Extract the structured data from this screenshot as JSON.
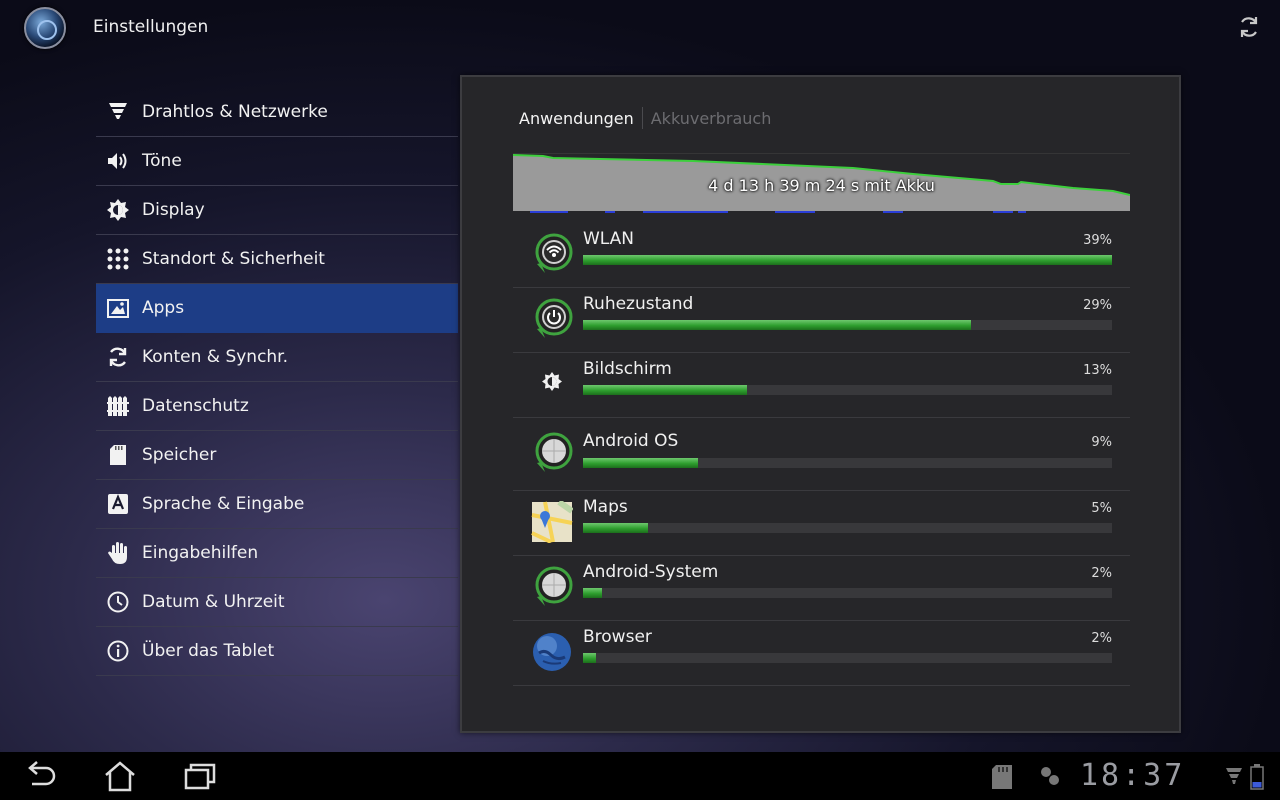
{
  "header": {
    "title": "Einstellungen"
  },
  "menu": [
    {
      "label": "Drahtlos & Netzwerke",
      "icon": "wifi-icon"
    },
    {
      "label": "Töne",
      "icon": "speaker-icon"
    },
    {
      "label": "Display",
      "icon": "brightness-icon"
    },
    {
      "label": "Standort & Sicherheit",
      "icon": "grid-icon"
    },
    {
      "label": "Apps",
      "icon": "apps-icon",
      "selected": true
    },
    {
      "label": "Konten & Synchr.",
      "icon": "sync-icon"
    },
    {
      "label": "Datenschutz",
      "icon": "fence-icon"
    },
    {
      "label": "Speicher",
      "icon": "sdcard-icon"
    },
    {
      "label": "Sprache & Eingabe",
      "icon": "keyboard-a-icon"
    },
    {
      "label": "Eingabehilfen",
      "icon": "hand-icon"
    },
    {
      "label": "Datum & Uhrzeit",
      "icon": "clock-icon"
    },
    {
      "label": "Über das Tablet",
      "icon": "info-icon"
    }
  ],
  "panel": {
    "tabs": {
      "active": "Anwendungen",
      "inactive": "Akkuverbrauch"
    },
    "battery_graph": {
      "label": "4 d 13 h 39 m 24 s mit Akku"
    },
    "usage": [
      {
        "name": "WLAN",
        "percent_label": "39%",
        "fraction": 1.0,
        "icon": "android-wifi-icon"
      },
      {
        "name": "Ruhezustand",
        "percent_label": "29%",
        "fraction": 0.734,
        "icon": "android-power-icon"
      },
      {
        "name": "Bildschirm",
        "percent_label": "13%",
        "fraction": 0.31,
        "icon": "brightness-icon"
      },
      {
        "name": "Android OS",
        "percent_label": "9%",
        "fraction": 0.218,
        "icon": "android-os-icon"
      },
      {
        "name": "Maps",
        "percent_label": "5%",
        "fraction": 0.123,
        "icon": "maps-icon"
      },
      {
        "name": "Android-System",
        "percent_label": "2%",
        "fraction": 0.036,
        "icon": "android-system-icon"
      },
      {
        "name": "Browser",
        "percent_label": "2%",
        "fraction": 0.025,
        "icon": "globe-icon"
      }
    ]
  },
  "system_bar": {
    "clock": "18:37"
  },
  "colors": {
    "selected": "#1d3d86",
    "bar_fill": "#2e9e2e",
    "graph_fill": "#9a9a9a",
    "graph_line": "#3ccf3c"
  }
}
